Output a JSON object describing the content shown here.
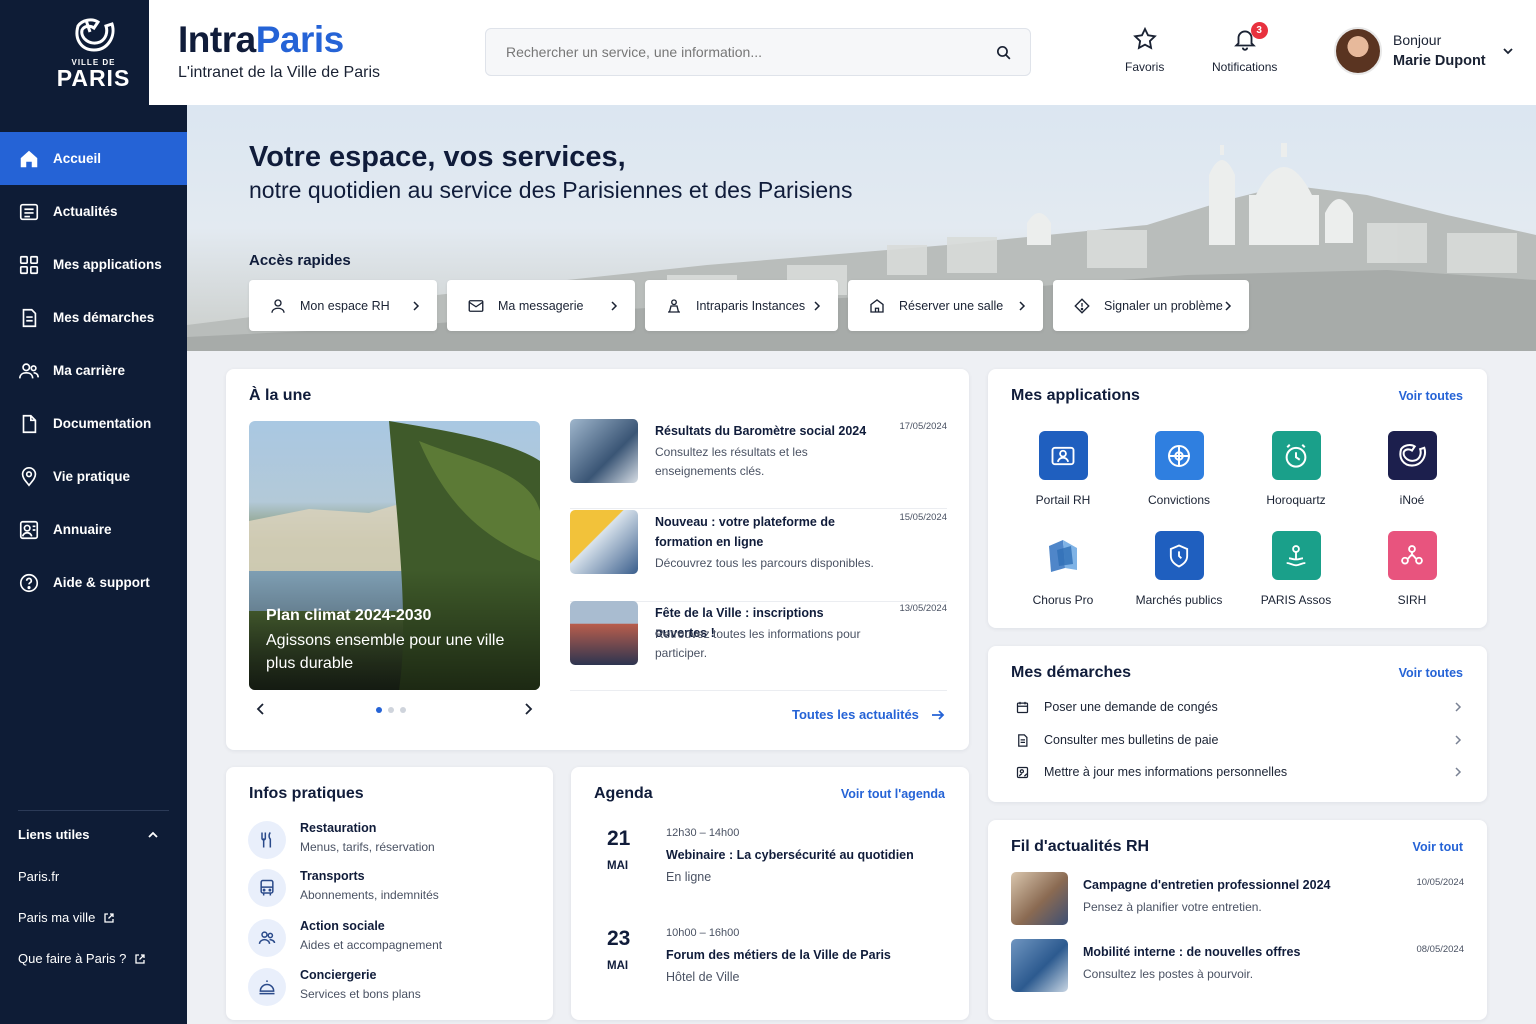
{
  "brand": {
    "logo_vdp": "VILLE DE",
    "logo_paris": "PARIS",
    "title_a": "Intra",
    "title_b": "Paris",
    "subtitle": "L'intranet de la Ville de Paris"
  },
  "search": {
    "placeholder": "Rechercher un service, une information..."
  },
  "header": {
    "favoris": "Favoris",
    "notifications": "Notifications",
    "notif_count": "3",
    "greeting": "Bonjour",
    "user_name": "Marie Dupont"
  },
  "colors": {
    "accent": "#2563d6",
    "sidebar": "#0e1c36",
    "badge": "#e8313e"
  },
  "sidebar": {
    "items": [
      {
        "label": "Accueil",
        "icon": "home-icon"
      },
      {
        "label": "Actualités",
        "icon": "newspaper-icon"
      },
      {
        "label": "Mes applications",
        "icon": "grid-icon"
      },
      {
        "label": "Mes démarches",
        "icon": "document-icon"
      },
      {
        "label": "Ma carrière",
        "icon": "people-icon"
      },
      {
        "label": "Documentation",
        "icon": "file-icon"
      },
      {
        "label": "Vie pratique",
        "icon": "map-pin-icon"
      },
      {
        "label": "Annuaire",
        "icon": "contacts-icon"
      },
      {
        "label": "Aide & support",
        "icon": "help-icon"
      }
    ],
    "links_title": "Liens utiles",
    "links": [
      "Paris.fr",
      "Paris ma ville",
      "Que faire à Paris ?"
    ]
  },
  "hero": {
    "title": "Votre espace, vos services,",
    "subtitle": "notre quotidien au service des Parisiennes et des Parisiens",
    "quick_title": "Accès rapides",
    "quick": [
      {
        "label": "Mon espace RH",
        "icon": "user-icon"
      },
      {
        "label": "Ma messagerie",
        "icon": "mail-icon"
      },
      {
        "label": "Intraparis Instances",
        "icon": "meeting-icon"
      },
      {
        "label": "Réserver une salle",
        "icon": "building-icon"
      },
      {
        "label": "Signaler un problème",
        "icon": "alert-diamond-icon"
      }
    ]
  },
  "une": {
    "title": "À la une",
    "feature_title": "Plan climat 2024-2030",
    "feature_text": "Agissons ensemble pour une ville plus durable",
    "news": [
      {
        "title": "Résultats du Baromètre social 2024",
        "desc": "Consultez les résultats et les enseignements clés.",
        "date": "17/05/2024"
      },
      {
        "title": "Nouveau : votre plateforme de formation en ligne",
        "desc": "Découvrez tous les parcours disponibles.",
        "date": "15/05/2024"
      },
      {
        "title": "Fête de la Ville : inscriptions ouvertes !",
        "desc": "Retrouvez toutes les informations pour participer.",
        "date": "13/05/2024"
      }
    ],
    "all_link": "Toutes les actualités"
  },
  "apps": {
    "title": "Mes applications",
    "link": "Voir toutes",
    "items": [
      {
        "label": "Portail RH",
        "icon": "id-card-icon",
        "color": "#1f5fbf"
      },
      {
        "label": "Convictions",
        "icon": "target-icon",
        "color": "#2f7fe0"
      },
      {
        "label": "Horoquartz",
        "icon": "clock-icon",
        "color": "#1aa08a"
      },
      {
        "label": "iNoé",
        "icon": "paris-logo-icon",
        "color": "#1c1f4d"
      },
      {
        "label": "Chorus Pro",
        "icon": "cube-icon",
        "color": "#4f86c9"
      },
      {
        "label": "Marchés publics",
        "icon": "shield-icon",
        "color": "#1f5fbf"
      },
      {
        "label": "PARIS Assos",
        "icon": "hand-heart-icon",
        "color": "#1aa08a"
      },
      {
        "label": "SIRH",
        "icon": "network-icon",
        "color": "#e8547e"
      }
    ]
  },
  "demarches": {
    "title": "Mes démarches",
    "link": "Voir toutes",
    "items": [
      {
        "label": "Poser une demande de congés",
        "icon": "calendar-icon"
      },
      {
        "label": "Consulter mes bulletins de paie",
        "icon": "payslip-icon"
      },
      {
        "label": "Mettre à jour mes informations personnelles",
        "icon": "user-edit-icon"
      }
    ]
  },
  "filrh": {
    "title": "Fil d'actualités RH",
    "link": "Voir tout",
    "items": [
      {
        "title": "Campagne d'entretien professionnel 2024",
        "desc": "Pensez à planifier votre entretien.",
        "date": "10/05/2024"
      },
      {
        "title": "Mobilité interne : de nouvelles offres",
        "desc": "Consultez les postes à pourvoir.",
        "date": "08/05/2024"
      }
    ]
  },
  "infos": {
    "title": "Infos pratiques",
    "items": [
      {
        "title": "Restauration",
        "desc": "Menus, tarifs, réservation",
        "icon": "cutlery-icon"
      },
      {
        "title": "Transports",
        "desc": "Abonnements, indemnités",
        "icon": "bus-icon"
      },
      {
        "title": "Action sociale",
        "desc": "Aides et accompagnement",
        "icon": "people-icon"
      },
      {
        "title": "Conciergerie",
        "desc": "Services et bons plans",
        "icon": "bell-service-icon"
      }
    ]
  },
  "agenda": {
    "title": "Agenda",
    "link": "Voir tout l'agenda",
    "events": [
      {
        "day": "21",
        "month": "MAI",
        "time": "12h30 – 14h00",
        "title": "Webinaire : La cybersécurité au quotidien",
        "place": "En ligne"
      },
      {
        "day": "23",
        "month": "MAI",
        "time": "10h00 – 16h00",
        "title": "Forum des métiers de la Ville de Paris",
        "place": "Hôtel de Ville"
      }
    ]
  }
}
